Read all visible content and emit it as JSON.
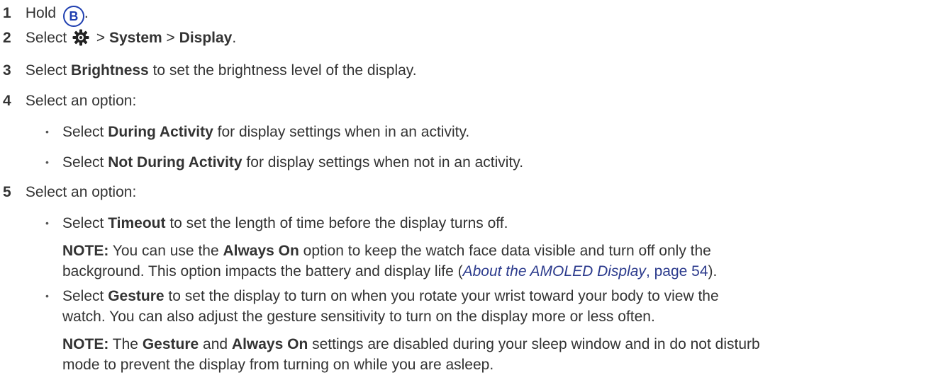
{
  "steps": [
    {
      "num": "1",
      "prefix": "Hold",
      "button": "B",
      "suffix": "."
    },
    {
      "num": "2",
      "prefix": "Select",
      "sep1": " > ",
      "item1": "System",
      "sep2": " > ",
      "item2": "Display",
      "suffix": "."
    },
    {
      "num": "3",
      "prefix": "Select ",
      "bold": "Brightness",
      "rest": " to set the brightness level of the display."
    },
    {
      "num": "4",
      "text": "Select an option:",
      "bullets": [
        {
          "prefix": "Select ",
          "bold": "During Activity",
          "rest": " for display settings when in an activity."
        },
        {
          "prefix": "Select ",
          "bold": "Not During Activity",
          "rest": " for display settings when not in an activity."
        }
      ]
    },
    {
      "num": "5",
      "text": "Select an option:",
      "bullets": [
        {
          "prefix": "Select ",
          "bold": "Timeout",
          "rest": " to set the length of time before the display turns off."
        },
        {
          "prefix": "Select ",
          "bold": "Gesture",
          "rest": " to set the display to turn on when you rotate your wrist toward your body to view the"
        }
      ]
    }
  ],
  "note1": {
    "label": "NOTE:",
    "t1": " You can use the ",
    "bold": "Always On",
    "t2": " option to keep the watch face data visible and turn off only the",
    "line2": "background. This option impacts the battery and display life (",
    "link_title": "About the AMOLED Display",
    "link_page": ", page 54",
    "end": ")."
  },
  "gesture_line2": "watch. You can also adjust the gesture sensitivity to turn on the display more or less often.",
  "note2": {
    "label": "NOTE:",
    "t1": " The ",
    "bold1": "Gesture",
    "t2": " and ",
    "bold2": "Always On",
    "t3": " settings are disabled during your sleep window and in do not disturb",
    "line2": "mode to prevent the display from turning on while you are asleep."
  },
  "colors": {
    "text": "#333333",
    "link": "#2b3a8c",
    "button_icon": "#1f3fb0"
  },
  "icons": [
    "b-button-icon",
    "gear-icon"
  ]
}
